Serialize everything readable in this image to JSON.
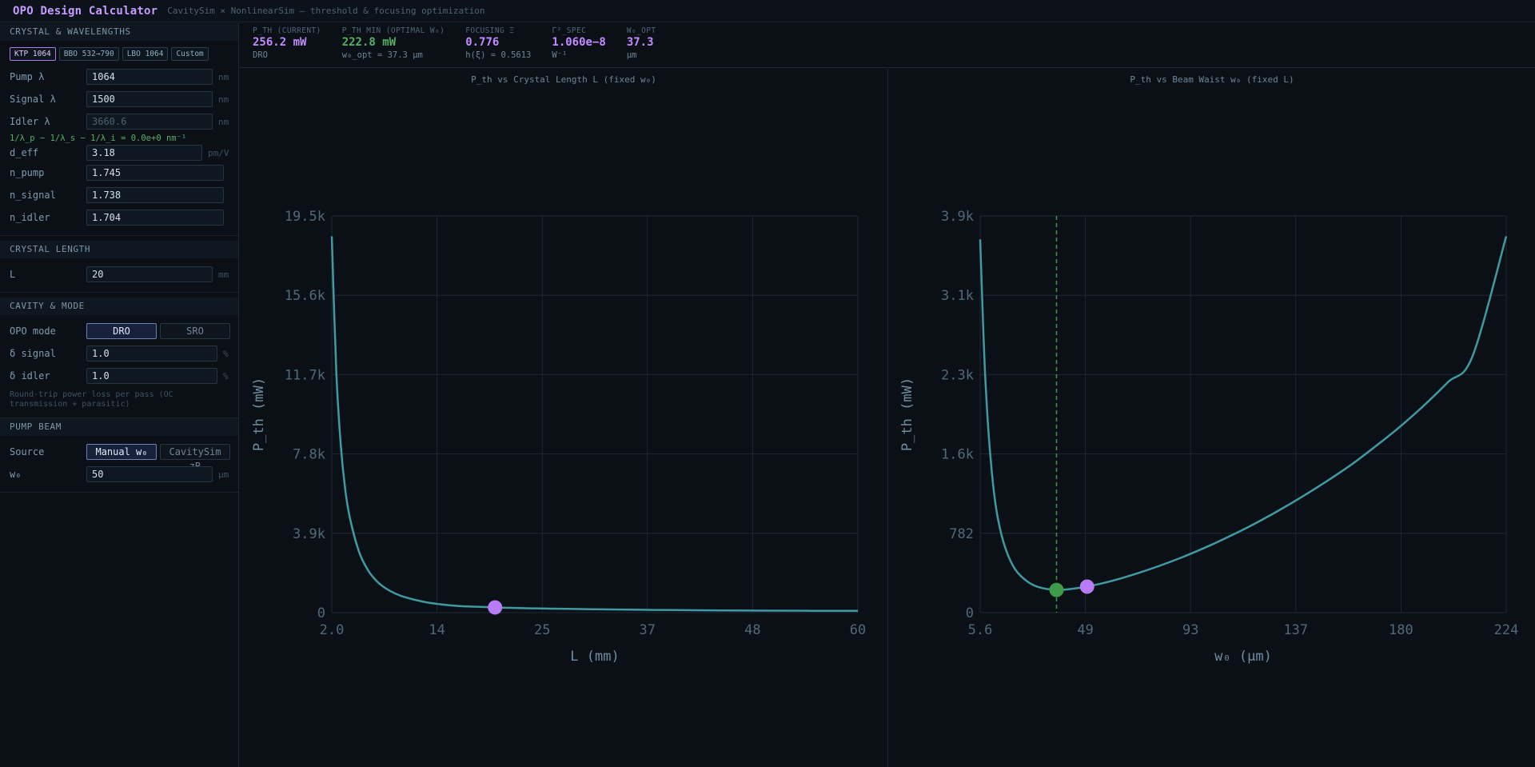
{
  "header": {
    "title": "OPO Design Calculator",
    "subtitle": "CavitySim × NonlinearSim — threshold & focusing optimization"
  },
  "sidebar": {
    "crystal": {
      "title": "CRYSTAL & WAVELENGTHS",
      "presets": [
        "KTP 1064",
        "BBO 532→790",
        "LBO 1064",
        "Custom"
      ],
      "active_preset": "KTP 1064",
      "pump_label": "Pump λ",
      "pump_value": "1064",
      "pump_unit": "nm",
      "signal_label": "Signal λ",
      "signal_value": "1500",
      "signal_unit": "nm",
      "idler_label": "Idler λ",
      "idler_value": "3660.6",
      "idler_unit": "nm",
      "energy_check": "1/λ_p − 1/λ_s − 1/λ_i = 0.0e+0 nm⁻¹",
      "deff_label": "d_eff",
      "deff_value": "3.18",
      "deff_unit": "pm/V",
      "npump_label": "n_pump",
      "npump_value": "1.745",
      "nsignal_label": "n_signal",
      "nsignal_value": "1.738",
      "nidler_label": "n_idler",
      "nidler_value": "1.704"
    },
    "length": {
      "title": "CRYSTAL LENGTH",
      "L_label": "L",
      "L_value": "20",
      "L_unit": "mm"
    },
    "cavity": {
      "title": "CAVITY & MODE",
      "mode_label": "OPO mode",
      "mode_options": [
        "DRO",
        "SRO"
      ],
      "mode_active": "DRO",
      "dsignal_label": "δ signal",
      "dsignal_value": "1.0",
      "dsignal_unit": "%",
      "didler_label": "δ idler",
      "didler_value": "1.0",
      "didler_unit": "%",
      "note": "Round-trip power loss per pass (OC transmission + parasitic)"
    },
    "pump_beam": {
      "title": "PUMP BEAM",
      "source_label": "Source",
      "source_options": [
        "Manual w₀",
        "CavitySim zR"
      ],
      "source_active": "Manual w₀",
      "w0_label": "w₀",
      "w0_value": "50",
      "w0_unit": "μm"
    }
  },
  "stats": [
    {
      "label": "P_TH (CURRENT)",
      "value": "256.2 mW",
      "sub": "DRO",
      "color": "#c38bff"
    },
    {
      "label": "P_TH MIN (OPTIMAL W₀)",
      "value": "222.8 mW",
      "sub": "w₀_opt = 37.3 μm",
      "color": "#56b363"
    },
    {
      "label": "FOCUSING Ξ",
      "value": "0.776",
      "sub": "h(ξ) = 0.5613",
      "color": "#c38bff"
    },
    {
      "label": "Γ²_SPEC",
      "value": "1.060e−8",
      "sub": "W⁻¹",
      "color": "#c38bff"
    },
    {
      "label": "W₀_OPT",
      "value": "37.3",
      "sub": "μm",
      "color": "#c38bff"
    }
  ],
  "colors": {
    "curve": "#3f9aa2",
    "current": "#b77cf5",
    "optimum": "#3f9a4a",
    "grid": "#1d2832",
    "tick": "#50697a"
  },
  "chart_data": [
    {
      "type": "line",
      "title": "P_th vs Crystal Length L (fixed w₀)",
      "xlabel": "L (mm)",
      "ylabel": "P_th (mW)",
      "xlim": [
        2.0,
        60
      ],
      "ylim": [
        0,
        19500
      ],
      "x_ticks": [
        "2.0",
        "14",
        "25",
        "37",
        "48",
        "60"
      ],
      "y_ticks": [
        "0",
        "3.9k",
        "7.8k",
        "11.7k",
        "15.6k",
        "19.5k"
      ],
      "grid": true,
      "x": [
        2,
        2.5,
        3,
        3.5,
        4,
        5,
        6,
        7,
        8,
        9,
        10,
        12,
        14,
        16,
        18,
        20,
        22,
        25,
        28,
        32,
        36,
        40,
        45,
        50,
        55,
        60
      ],
      "y": [
        18500,
        11800,
        8200,
        6000,
        4650,
        3000,
        2080,
        1530,
        1180,
        940,
        770,
        545,
        410,
        325,
        290,
        256,
        230,
        205,
        185,
        160,
        140,
        125,
        110,
        100,
        92,
        85
      ],
      "current_point": {
        "x": 20,
        "y": 256
      }
    },
    {
      "type": "line",
      "title": "P_th vs Beam Waist w₀ (fixed L)",
      "xlabel": "w₀ (μm)",
      "ylabel": "P_th (mW)",
      "xlim": [
        5.6,
        224
      ],
      "ylim": [
        0,
        3900
      ],
      "x_ticks": [
        "5.6",
        "49",
        "93",
        "137",
        "180",
        "224"
      ],
      "y_ticks": [
        "0",
        "782",
        "1.6k",
        "2.3k",
        "3.1k",
        "3.9k"
      ],
      "grid": true,
      "x": [
        5.6,
        6.5,
        7.5,
        9,
        11,
        13,
        16,
        20,
        25,
        30,
        37.3,
        43,
        50,
        60,
        70,
        80,
        90,
        100,
        110,
        120,
        130,
        140,
        150,
        160,
        170,
        180,
        190,
        200,
        210,
        224
      ],
      "y": [
        3670,
        3050,
        2420,
        1800,
        1250,
        920,
        640,
        430,
        310,
        250,
        223,
        232,
        256,
        310,
        380,
        460,
        550,
        650,
        760,
        880,
        1010,
        1150,
        1300,
        1460,
        1640,
        1830,
        2040,
        2270,
        2520,
        3700
      ],
      "optimum_point": {
        "x": 37.3,
        "y": 223
      },
      "current_point": {
        "x": 50,
        "y": 256
      }
    }
  ]
}
